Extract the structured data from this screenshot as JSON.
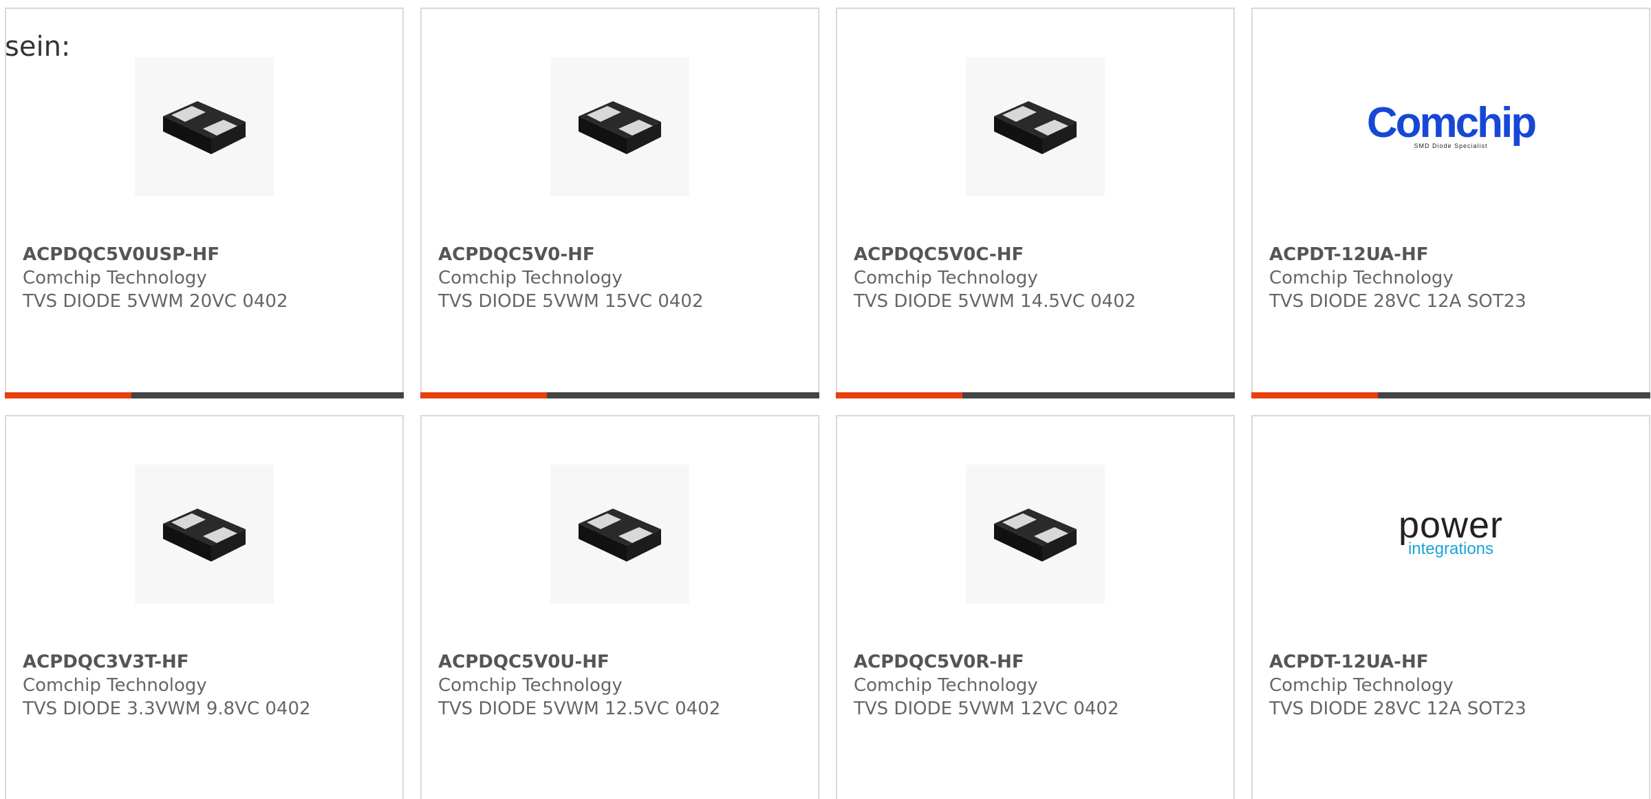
{
  "lead_text": "sein:",
  "colors": {
    "accent": "#e8400c",
    "bar": "#444444",
    "border": "#d9d9d9",
    "comchip_blue": "#1747d6",
    "power_blue": "#1ba3d8"
  },
  "products": [
    {
      "part": "ACPDQC5V0USP-HF",
      "maker": "Comchip Technology",
      "desc": "TVS DIODE 5VWM 20VC 0402",
      "image": "diode-package-photo"
    },
    {
      "part": "ACPDQC5V0-HF",
      "maker": "Comchip Technology",
      "desc": "TVS DIODE 5VWM 15VC 0402",
      "image": "diode-package-photo"
    },
    {
      "part": "ACPDQC5V0C-HF",
      "maker": "Comchip Technology",
      "desc": "TVS DIODE 5VWM 14.5VC 0402",
      "image": "diode-package-photo"
    },
    {
      "part": "ACPDT-12UA-HF",
      "maker": "Comchip Technology",
      "desc": "TVS DIODE 28VC 12A SOT23",
      "image": "comchip-logo",
      "logo_word": "Comchip",
      "logo_tag": "SMD Diode Specialist"
    },
    {
      "part": "ACPDQC3V3T-HF",
      "maker": "Comchip Technology",
      "desc": "TVS DIODE 3.3VWM 9.8VC 0402",
      "image": "diode-package-photo"
    },
    {
      "part": "ACPDQC5V0U-HF",
      "maker": "Comchip Technology",
      "desc": "TVS DIODE 5VWM 12.5VC 0402",
      "image": "diode-package-photo"
    },
    {
      "part": "ACPDQC5V0R-HF",
      "maker": "Comchip Technology",
      "desc": "TVS DIODE 5VWM 12VC 0402",
      "image": "diode-package-photo"
    },
    {
      "part": "ACPDT-12UA-HF",
      "maker": "Comchip Technology",
      "desc": "TVS DIODE 28VC 12A SOT23",
      "image": "power-integrations-logo",
      "logo_word": "power",
      "logo_sub": "integrations"
    }
  ]
}
